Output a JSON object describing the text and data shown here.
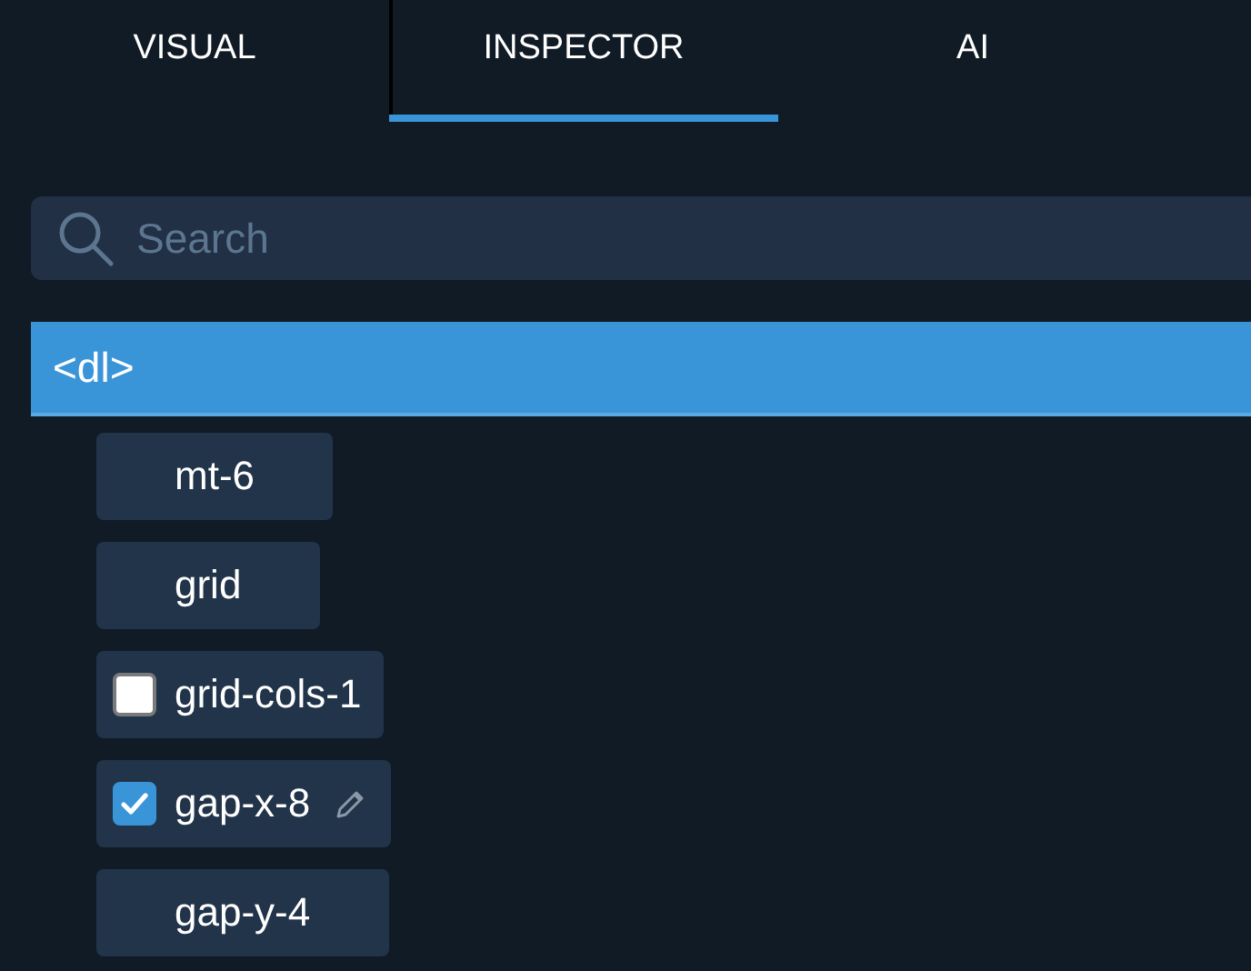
{
  "tabs": [
    {
      "label": "VISUAL",
      "selected": false
    },
    {
      "label": "INSPECTOR",
      "selected": true
    },
    {
      "label": "AI",
      "selected": false
    }
  ],
  "search": {
    "placeholder": "Search"
  },
  "element": {
    "label": "<dl>",
    "selected": true
  },
  "classes": [
    {
      "label": "mt-6",
      "kind": "plain"
    },
    {
      "label": "grid",
      "kind": "plain"
    },
    {
      "label": "grid-cols-1",
      "kind": "checkbox",
      "checked": false,
      "editable": false
    },
    {
      "label": "gap-x-8",
      "kind": "checkbox",
      "checked": true,
      "editable": true
    },
    {
      "label": "gap-y-4",
      "kind": "plain"
    }
  ]
}
